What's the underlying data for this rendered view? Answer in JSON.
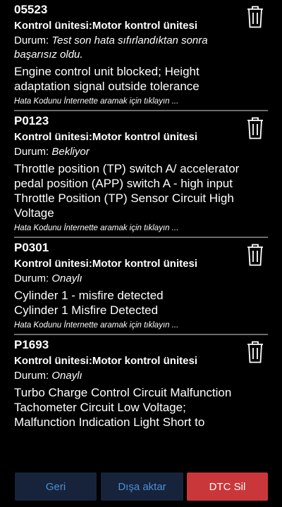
{
  "dtcs": [
    {
      "code": "05523",
      "unit": "Kontrol ünitesi:Motor kontrol ünitesi",
      "status_label": "Durum: ",
      "status_value": "Test son hata sıfırlandıktan sonra başarısız oldu.",
      "description": "Engine control unit blocked; Height adaptation signal outside tolerance",
      "search_link": "Hata Kodunu İnternette aramak için tıklayın ..."
    },
    {
      "code": "P0123",
      "unit": "Kontrol ünitesi:Motor kontrol ünitesi",
      "status_label": "Durum: ",
      "status_value": "Bekliyor",
      "description": "Throttle position (TP) switch A/ accelerator pedal position (APP) switch A - high input\nThrottle Position (TP) Sensor Circuit High Voltage",
      "search_link": "Hata Kodunu İnternette aramak için tıklayın ..."
    },
    {
      "code": "P0301",
      "unit": "Kontrol ünitesi:Motor kontrol ünitesi",
      "status_label": "Durum: ",
      "status_value": "Onaylı",
      "description": "Cylinder 1 - misfire detected\nCylinder 1 Misfire Detected",
      "search_link": "Hata Kodunu İnternette aramak için tıklayın ..."
    },
    {
      "code": "P1693",
      "unit": "Kontrol ünitesi:Motor kontrol ünitesi",
      "status_label": "Durum: ",
      "status_value": "Onaylı",
      "description": "Turbo Charge Control Circuit Malfunction\nTachometer Circuit Low Voltage; Malfunction Indication Light Short to",
      "search_link": ""
    }
  ],
  "icons": {
    "delete": "trash-icon"
  },
  "buttons": {
    "back": "Geri",
    "export": "Dışa aktar",
    "clear_dtc": "DTC Sil"
  },
  "colors": {
    "background": "#000000",
    "button_dark": "#17233a",
    "button_text": "#4a8fd8",
    "button_danger": "#c9373a",
    "separator": "#6b6b6b"
  }
}
